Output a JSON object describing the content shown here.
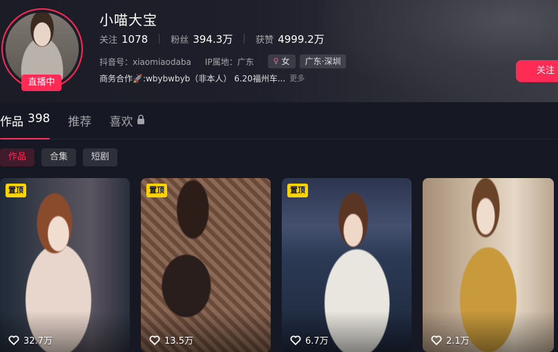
{
  "profile": {
    "name": "小喵大宝",
    "live_badge": "直播中",
    "stats": [
      {
        "label": "关注",
        "value": "1078"
      },
      {
        "label": "粉丝",
        "value": "394.3万"
      },
      {
        "label": "获赞",
        "value": "4999.2万"
      }
    ],
    "douyin_id": "抖音号：xiaomiaodaba",
    "ip_location": "IP属地：广东",
    "gender_tag": "女",
    "location_tag": "广东·深圳",
    "bio": "商务合作🚀:wbybwbyb（非本人） 6.20福州车...",
    "bio_more": "更多",
    "follow_label": "关注"
  },
  "tabs": [
    {
      "label": "作品",
      "count": "398"
    },
    {
      "label": "推荐",
      "count": ""
    },
    {
      "label": "喜欢",
      "count": ""
    }
  ],
  "subtabs": [
    "作品",
    "合集",
    "短剧"
  ],
  "videos": [
    {
      "pinned": "置顶",
      "likes": "32.7万"
    },
    {
      "pinned": "置顶",
      "likes": "13.5万"
    },
    {
      "pinned": "置顶",
      "likes": "6.7万"
    },
    {
      "pinned": "",
      "likes": "2.1万"
    }
  ],
  "colors": {
    "accent": "#fe2c55",
    "background": "#161823",
    "pin": "#fed400"
  },
  "icons": [
    "heart-icon",
    "lock-icon",
    "female-icon"
  ]
}
